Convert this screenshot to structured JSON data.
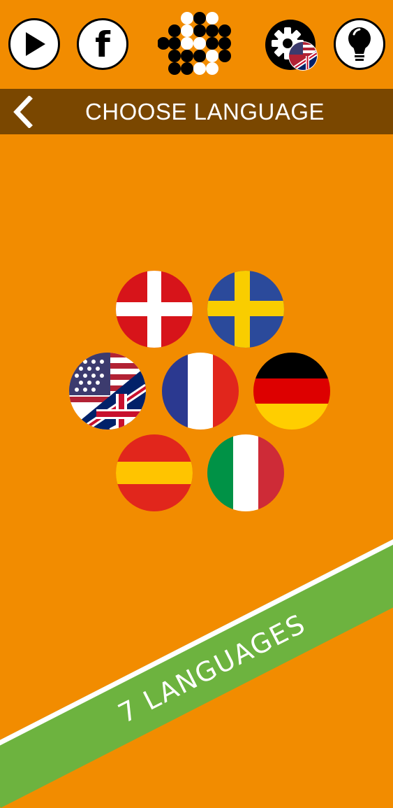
{
  "header": {
    "title": "CHOOSE LANGUAGE",
    "back_icon": "chevron-left-icon"
  },
  "topbar": {
    "play_icon": "play-icon",
    "facebook_icon": "facebook-icon",
    "facebook_letter": "f",
    "logo": "dots-logo",
    "settings_icon": "gear-icon",
    "hint_icon": "lightbulb-icon"
  },
  "languages": [
    {
      "flag": "denmark"
    },
    {
      "flag": "sweden"
    },
    {
      "flag": "usa-uk"
    },
    {
      "flag": "france"
    },
    {
      "flag": "germany"
    },
    {
      "flag": "spain"
    },
    {
      "flag": "italy"
    }
  ],
  "banner": {
    "text": "7 LANGUAGES"
  },
  "colors": {
    "background": "#F28C00",
    "header": "#7A4700",
    "banner": "#6DB33F"
  }
}
